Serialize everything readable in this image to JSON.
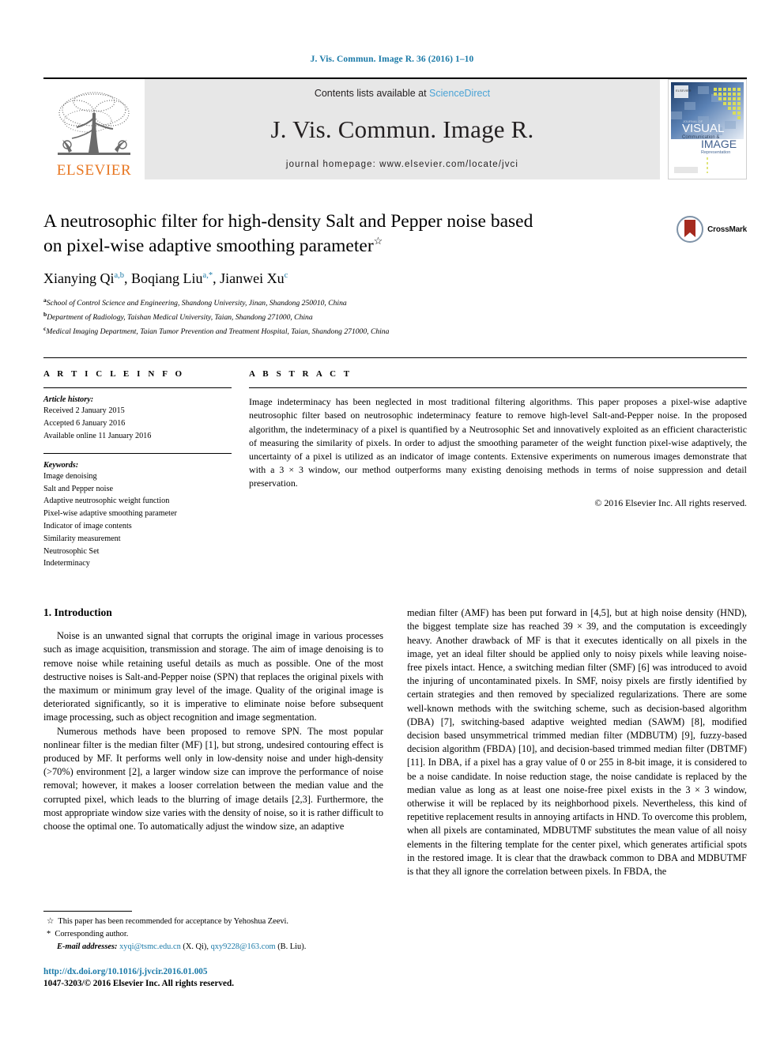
{
  "running_head": "J. Vis. Commun. Image R. 36 (2016) 1–10",
  "masthead": {
    "contents_prefix": "Contents lists available at ",
    "sciencedirect": "ScienceDirect",
    "journal_title": "J. Vis. Commun. Image R.",
    "homepage": "journal homepage: www.elsevier.com/locate/jvci",
    "publisher_name": "ELSEVIER",
    "cover_text": {
      "line1": "VISUAL",
      "line2": "Communication &",
      "line3": "IMAGE",
      "line4": "Representation",
      "kicker": "JOURNAL OF"
    }
  },
  "article": {
    "title": "A neutrosophic filter for high-density Salt and Pepper noise based on pixel-wise adaptive smoothing parameter",
    "title_footnote_marker": "☆",
    "crossmark_label": "CrossMark",
    "authors": [
      {
        "name": "Xianying Qi",
        "sup": "a,b",
        "sep": ", "
      },
      {
        "name": "Boqiang Liu",
        "sup": "a,*",
        "sep": ", "
      },
      {
        "name": "Jianwei Xu",
        "sup": "c",
        "sep": ""
      }
    ],
    "affiliations": [
      {
        "marker": "a",
        "text": "School of Control Science and Engineering, Shandong University, Jinan, Shandong 250010, China"
      },
      {
        "marker": "b",
        "text": "Department of Radiology, Taishan Medical University, Taian, Shandong 271000, China"
      },
      {
        "marker": "c",
        "text": "Medical Imaging Department, Taian Tumor Prevention and Treatment Hospital, Taian, Shandong 271000, China"
      }
    ]
  },
  "article_info": {
    "heading": "A R T I C L E  I N F O",
    "history_label": "Article history:",
    "history": [
      "Received 2 January 2015",
      "Accepted 6 January 2016",
      "Available online 11 January 2016"
    ],
    "keywords_label": "Keywords:",
    "keywords": [
      "Image denoising",
      "Salt and Pepper noise",
      "Adaptive neutrosophic weight function",
      "Pixel-wise adaptive smoothing parameter",
      "Indicator of image contents",
      "Similarity measurement",
      "Neutrosophic Set",
      "Indeterminacy"
    ]
  },
  "abstract": {
    "heading": "A B S T R A C T",
    "text": "Image indeterminacy has been neglected in most traditional filtering algorithms. This paper proposes a pixel-wise adaptive neutrosophic filter based on neutrosophic indeterminacy feature to remove high-level Salt-and-Pepper noise. In the proposed algorithm, the indeterminacy of a pixel is quantified by a Neutrosophic Set and innovatively exploited as an efficient characteristic of measuring the similarity of pixels. In order to adjust the smoothing parameter of the weight function pixel-wise adaptively, the uncertainty of a pixel is utilized as an indicator of image contents. Extensive experiments on numerous images demonstrate that with a 3 × 3 window, our method outperforms many existing denoising methods in terms of noise suppression and detail preservation.",
    "copyright": "© 2016 Elsevier Inc. All rights reserved."
  },
  "body": {
    "section_number_title": "1. Introduction",
    "left_paragraphs": [
      "Noise is an unwanted signal that corrupts the original image in various processes such as image acquisition, transmission and storage. The aim of image denoising is to remove noise while retaining useful details as much as possible. One of the most destructive noises is Salt-and-Pepper noise (SPN) that replaces the original pixels with the maximum or minimum gray level of the image. Quality of the original image is deteriorated significantly, so it is imperative to eliminate noise before subsequent image processing, such as object recognition and image segmentation.",
      "Numerous methods have been proposed to remove SPN. The most popular nonlinear filter is the median filter (MF) [1], but strong, undesired contouring effect is produced by MF. It performs well only in low-density noise and under high-density (>70%) environment [2], a larger window size can improve the performance of noise removal; however, it makes a looser correlation between the median value and the corrupted pixel, which leads to the blurring of image details [2,3]. Furthermore, the most appropriate window size varies with the density of noise, so it is rather difficult to choose the optimal one. To automatically adjust the window size, an adaptive"
    ],
    "right_paragraphs": [
      "median filter (AMF) has been put forward in [4,5], but at high noise density (HND), the biggest template size has reached 39 × 39, and the computation is exceedingly heavy. Another drawback of MF is that it executes identically on all pixels in the image, yet an ideal filter should be applied only to noisy pixels while leaving noise-free pixels intact. Hence, a switching median filter (SMF) [6] was introduced to avoid the injuring of uncontaminated pixels. In SMF, noisy pixels are firstly identified by certain strategies and then removed by specialized regularizations. There are some well-known methods with the switching scheme, such as decision-based algorithm (DBA) [7], switching-based adaptive weighted median (SAWM) [8], modified decision based unsymmetrical trimmed median filter (MDBUTM) [9], fuzzy-based decision algorithm (FBDA) [10], and decision-based trimmed median filter (DBTMF) [11]. In DBA, if a pixel has a gray value of 0 or 255 in 8-bit image, it is considered to be a noise candidate. In noise reduction stage, the noise candidate is replaced by the median value as long as at least one noise-free pixel exists in the 3 × 3 window, otherwise it will be replaced by its neighborhood pixels. Nevertheless, this kind of repetitive replacement results in annoying artifacts in HND. To overcome this problem, when all pixels are contaminated, MDBUTMF substitutes the mean value of all noisy elements in the filtering template for the center pixel, which generates artificial spots in the restored image. It is clear that the drawback common to DBA and MDBUTMF is that they all ignore the correlation between pixels. In FBDA, the"
    ]
  },
  "footnotes": {
    "star_note": "This paper has been recommended for acceptance by Yehoshua Zeevi.",
    "star_marker": "☆",
    "corresponding_marker": "*",
    "corresponding_note": "Corresponding author.",
    "emails_label": "E-mail addresses:",
    "emails": [
      {
        "address": "xyqi@tsmc.edu.cn",
        "owner": "(X. Qi)"
      },
      {
        "address": "qxy9228@163.com",
        "owner": "(B. Liu)"
      }
    ]
  },
  "footer": {
    "doi": "http://dx.doi.org/10.1016/j.jvcir.2016.01.005",
    "issn_line": "1047-3203/© 2016 Elsevier Inc. All rights reserved."
  },
  "colors": {
    "link_blue": "#1b7aa8",
    "sciencedirect_blue": "#4aa3d6",
    "elsevier_orange": "#E87722",
    "masthead_gray": "#e7e7e7"
  }
}
